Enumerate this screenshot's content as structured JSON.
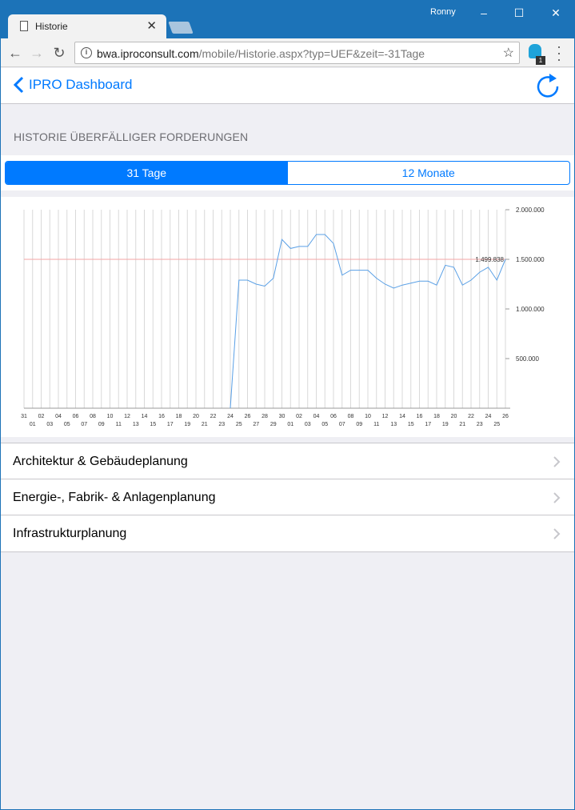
{
  "browser": {
    "tab_title": "Historie",
    "user": "Ronny",
    "url_host": "bwa.iproconsult.com",
    "url_path": "/mobile/Historie.aspx?typ=UEF&zeit=-31Tage",
    "extension_badge": "1"
  },
  "app": {
    "back_label": "IPRO Dashboard",
    "section_title": "HISTORIE ÜBERFÄLLIGER FORDERUNGEN",
    "segments": [
      "31 Tage",
      "12 Monate"
    ],
    "active_segment": 0
  },
  "chart_data": {
    "type": "line",
    "y_ticks": [
      "2.000.000",
      "1.500.000",
      "1.000.000",
      "500.000"
    ],
    "ylim": [
      0,
      2000000
    ],
    "reference_line": 1500000,
    "last_value_label": "1.499.838",
    "x_labels_top": [
      "31",
      "02",
      "04",
      "06",
      "08",
      "10",
      "12",
      "14",
      "16",
      "18",
      "20",
      "22",
      "24",
      "26",
      "28",
      "30",
      "02",
      "04",
      "06",
      "08",
      "10",
      "12",
      "14",
      "16",
      "18",
      "20",
      "22",
      "24",
      "26"
    ],
    "x_labels_bottom": [
      "01",
      "03",
      "05",
      "07",
      "09",
      "11",
      "13",
      "15",
      "17",
      "19",
      "21",
      "23",
      "25",
      "27",
      "29",
      "01",
      "03",
      "05",
      "07",
      "09",
      "11",
      "13",
      "15",
      "17",
      "19",
      "21",
      "23",
      "25"
    ],
    "series": [
      {
        "color": "#5aa0e6",
        "values": [
          null,
          null,
          null,
          null,
          null,
          null,
          null,
          null,
          null,
          null,
          null,
          null,
          null,
          null,
          null,
          null,
          null,
          null,
          null,
          null,
          null,
          null,
          null,
          null,
          0,
          1290000,
          1290000,
          1250000,
          1230000,
          1310000,
          1700000,
          1610000,
          1630000,
          1630000,
          1750000,
          1750000,
          1660000,
          1340000,
          1390000,
          1390000,
          1390000,
          1310000,
          1250000,
          1210000,
          1240000,
          1260000,
          1280000,
          1280000,
          1240000,
          1440000,
          1420000,
          1240000,
          1290000,
          1370000,
          1420000,
          1290000,
          1499838
        ]
      }
    ]
  },
  "categories": [
    {
      "label": "Architektur & Gebäudeplanung"
    },
    {
      "label": "Energie-, Fabrik- & Anlagenplanung"
    },
    {
      "label": "Infrastrukturplanung"
    }
  ],
  "colors": {
    "accent": "#007aff",
    "titlebar": "#1c73b8",
    "reference_line": "#f3a5a5"
  }
}
